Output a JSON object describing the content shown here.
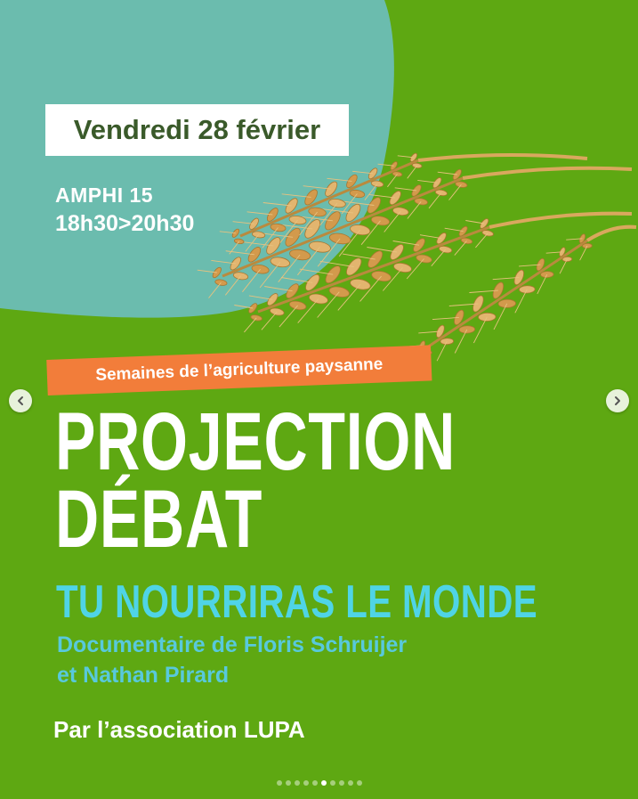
{
  "poster": {
    "date": "Vendredi 28 février",
    "venue": "AMPHI 15",
    "time": "18h30>20h30",
    "tag": "Semaines de l’agriculture paysanne",
    "headline_1": "PROJECTION",
    "headline_2": "DÉBAT",
    "film_title": "TU NOURRIRAS LE MONDE",
    "doc_line_1": "Documentaire de Floris Schruijer",
    "doc_line_2": "et Nathan Pirard",
    "organizer": "Par l’association LUPA"
  },
  "carousel": {
    "prev_icon": "chevron-left-icon",
    "next_icon": "chevron-right-icon",
    "dot_count": 10,
    "active_index": 5
  },
  "colors": {
    "background": "#5ea812",
    "blob": "#6bbcae",
    "tag": "#f27d3a",
    "film_title": "#4fd4e6",
    "date_text": "#3a5a2a"
  }
}
